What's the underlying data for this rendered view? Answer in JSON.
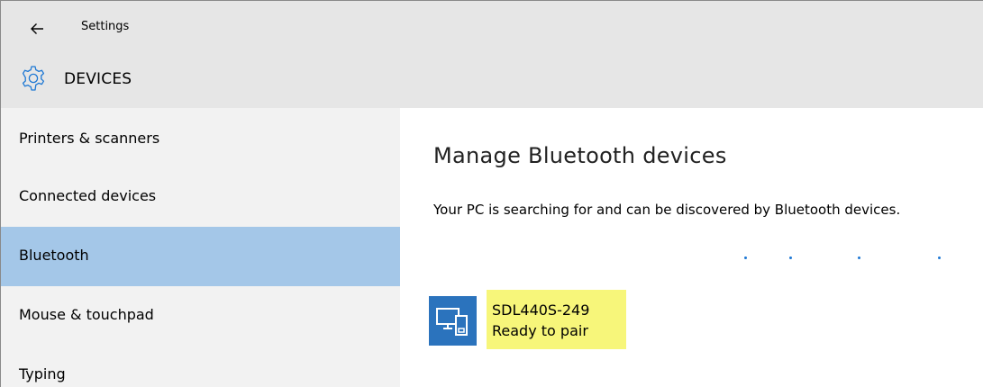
{
  "window": {
    "app_title": "Settings"
  },
  "header": {
    "page_title": "DEVICES"
  },
  "sidebar": {
    "items": [
      {
        "label": "Printers & scanners",
        "selected": false
      },
      {
        "label": "Connected devices",
        "selected": false
      },
      {
        "label": "Bluetooth",
        "selected": true
      },
      {
        "label": "Mouse & touchpad",
        "selected": false
      },
      {
        "label": "Typing",
        "selected": false
      }
    ]
  },
  "main": {
    "section_title": "Manage Bluetooth devices",
    "status_text": "Your PC is searching for and can be discovered by Bluetooth devices.",
    "devices": [
      {
        "name": "SDL440S-249",
        "status": "Ready to pair",
        "icon": "computer-phone-icon"
      }
    ]
  },
  "colors": {
    "header_bg": "#e6e6e6",
    "sidebar_bg": "#f2f2f2",
    "selected_bg": "#a4c7e8",
    "accent": "#1e78d4",
    "device_tile": "#2b73bd",
    "highlight": "#f7f67a"
  }
}
